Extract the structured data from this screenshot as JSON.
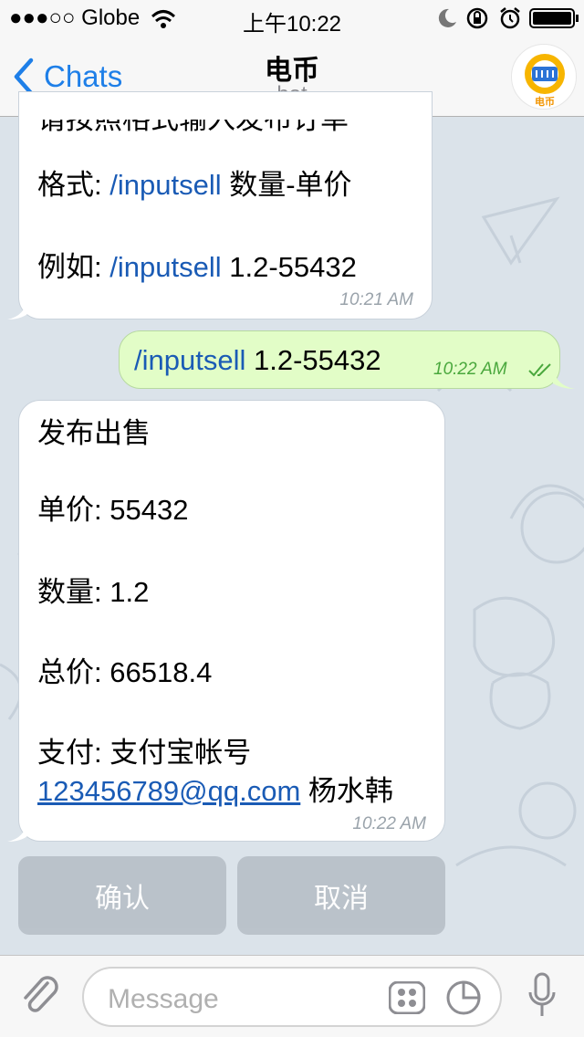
{
  "status_bar": {
    "carrier": "●●●○○ Globe",
    "time": "上午10:22"
  },
  "nav": {
    "back_label": "Chats",
    "title": "电币",
    "subtitle": "bot",
    "avatar_text": "电币"
  },
  "messages": {
    "m1": {
      "partial_line": "请按照格式输入发布订单",
      "format_label": "格式:",
      "format_cmd": "/inputsell",
      "format_rest": "数量-单价",
      "example_label": "例如:",
      "example_cmd": "/inputsell",
      "example_rest": "1.2-55432",
      "time": "10:21 AM"
    },
    "m2": {
      "cmd": "/inputsell",
      "rest": "1.2-55432",
      "time": "10:22 AM"
    },
    "m3": {
      "title": "发布出售",
      "price_label": "单价:",
      "price": "55432",
      "qty_label": "数量:",
      "qty": "1.2",
      "total_label": "总价:",
      "total": "66518.4",
      "pay_label": "支付:",
      "pay_method": "支付宝帐号",
      "email": "123456789@qq.com",
      "name": "杨水韩",
      "time": "10:22 AM"
    }
  },
  "keyboard": {
    "confirm": "确认",
    "cancel": "取消"
  },
  "input": {
    "placeholder": "Message"
  },
  "colors": {
    "accent": "#1e7fe8",
    "outgoing": "#e2fdc7",
    "incoming": "#ffffff",
    "link": "#1a5bb5"
  }
}
